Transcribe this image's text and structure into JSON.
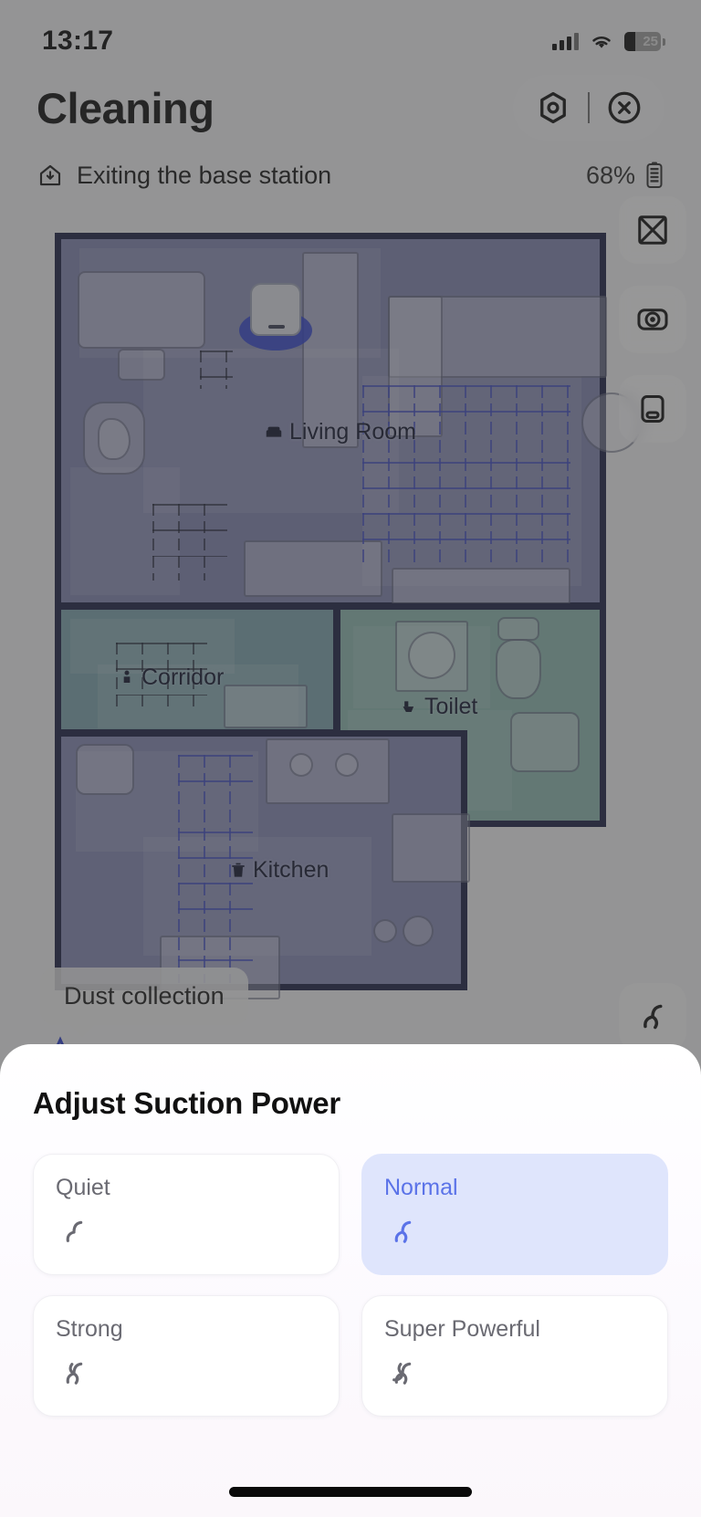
{
  "status_bar": {
    "time": "13:17",
    "cellular_icon": "signal-bars-icon",
    "wifi_icon": "wifi-icon",
    "battery_level": "25",
    "battery_icon": "battery-icon"
  },
  "header": {
    "title": "Cleaning",
    "settings_icon": "hexagon-settings-icon",
    "close_icon": "close-circle-icon",
    "status_icon": "home-return-icon",
    "status_text": "Exiting the base station",
    "battery_percent": "68%",
    "battery_icon": "battery-vertical-icon"
  },
  "map": {
    "rooms": [
      {
        "name": "Living Room",
        "icon": "sofa-icon",
        "color": "#7e82ad"
      },
      {
        "name": "Corridor",
        "icon": "person-icon",
        "color": "#7ba1ab"
      },
      {
        "name": "Toilet",
        "icon": "toilet-icon",
        "color": "#8ab4ac"
      },
      {
        "name": "Kitchen",
        "icon": "trash-icon",
        "color": "#8286b0"
      }
    ],
    "wall_color": "#1c2044",
    "robot_marker": "robot-vacuum-icon",
    "tooltip": "Dust collection",
    "rail_buttons": [
      {
        "icon": "no-go-zone-icon",
        "name": "partition-button"
      },
      {
        "icon": "camera-view-icon",
        "name": "map-view-button"
      },
      {
        "icon": "dock-station-icon",
        "name": "base-station-button"
      }
    ],
    "fan_button_icon": "fan-icon"
  },
  "sheet": {
    "title": "Adjust Suction Power",
    "selected": "Normal",
    "accent_color": "#5b73e8",
    "selected_bg": "#dfe5fc",
    "modes": [
      {
        "label": "Quiet",
        "icon": "fan-1-icon",
        "selected": false
      },
      {
        "label": "Normal",
        "icon": "fan-2-icon",
        "selected": true
      },
      {
        "label": "Strong",
        "icon": "fan-3-icon",
        "selected": false
      },
      {
        "label": "Super Powerful",
        "icon": "fan-4-icon",
        "selected": false
      }
    ]
  }
}
